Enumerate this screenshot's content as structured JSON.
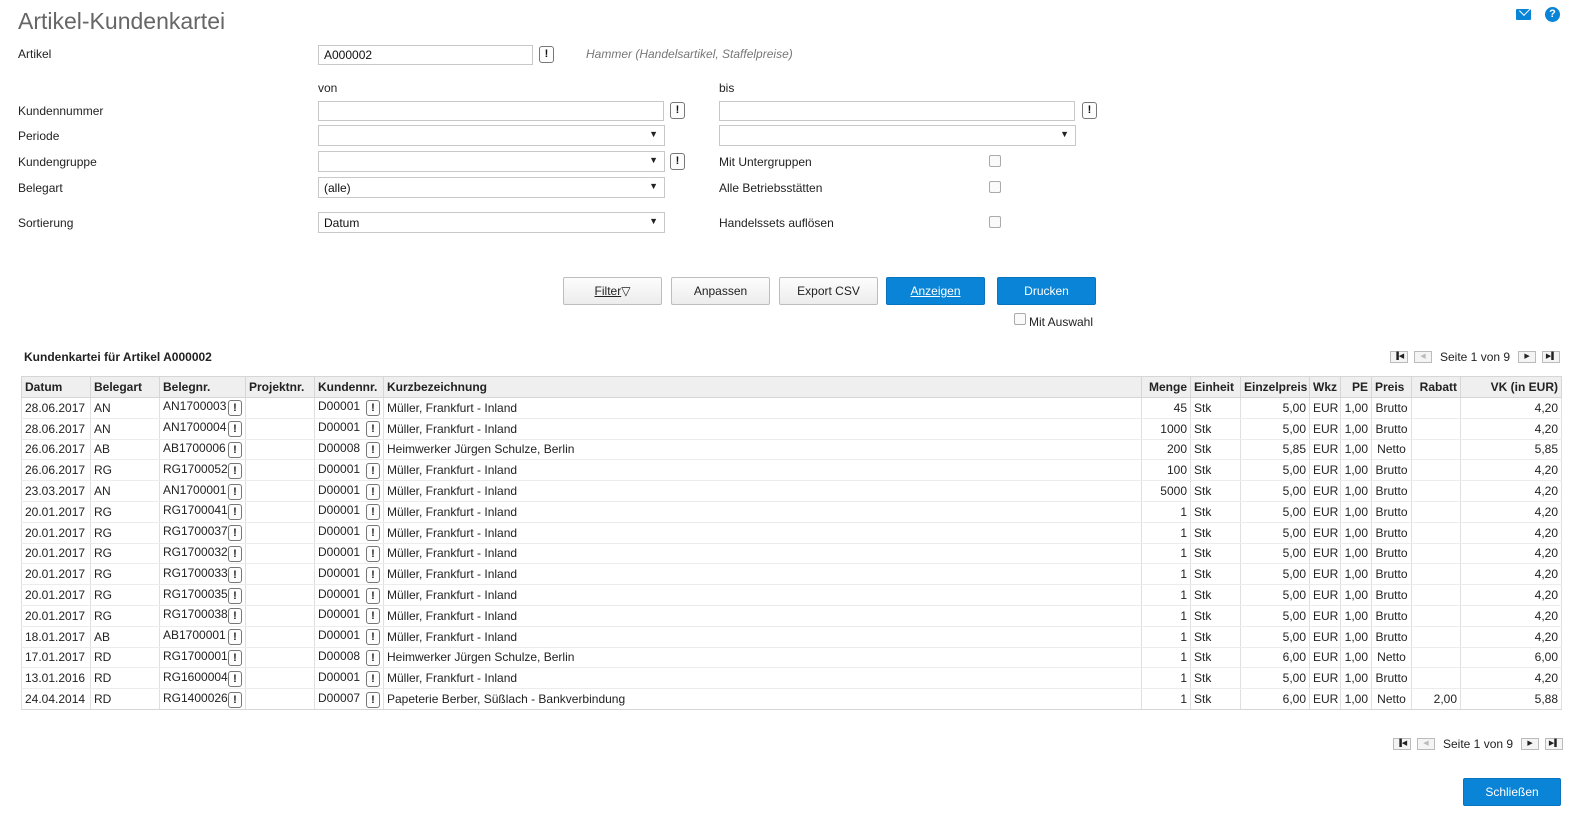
{
  "page": {
    "title": "Artikel-Kundenkartei"
  },
  "icons": {
    "mail": "mail-icon",
    "help": "help-icon"
  },
  "form": {
    "artikel_label": "Artikel",
    "artikel_value": "A000002",
    "artikel_hint": "Hammer (Handelsartikel, Staffelpreise)",
    "von_label": "von",
    "bis_label": "bis",
    "kundennummer_label": "Kundennummer",
    "periode_label": "Periode",
    "kundengruppe_label": "Kundengruppe",
    "belegart_label": "Belegart",
    "belegart_value": "(alle)",
    "sortierung_label": "Sortierung",
    "sortierung_value": "Datum",
    "mit_untergruppen_label": "Mit Untergruppen",
    "alle_betriebsstaetten_label": "Alle Betriebsstätten",
    "handelssets_label": "Handelssets auflösen",
    "mit_auswahl_label": "Mit Auswahl"
  },
  "buttons": {
    "filter": "Filter",
    "anpassen": "Anpassen",
    "export_csv": "Export CSV",
    "anzeigen": "Anzeigen",
    "drucken": "Drucken",
    "schliessen": "Schließen"
  },
  "table": {
    "caption": "Kundenkartei für Artikel A000002",
    "pager_text": "Seite 1 von 9",
    "columns": [
      "Datum",
      "Belegart",
      "Belegnr.",
      "Projektnr.",
      "Kundennr.",
      "Kurzbezeichnung",
      "Menge",
      "Einheit",
      "Einzelpreis",
      "Wkz",
      "PE",
      "Preis",
      "Rabatt",
      "VK (in EUR)"
    ],
    "rows": [
      [
        "28.06.2017",
        "AN",
        "AN1700003",
        "",
        "D00001",
        "Müller, Frankfurt - Inland",
        "45",
        "Stk",
        "5,00",
        "EUR",
        "1,00",
        "Brutto",
        "",
        "4,20"
      ],
      [
        "28.06.2017",
        "AN",
        "AN1700004",
        "",
        "D00001",
        "Müller, Frankfurt - Inland",
        "1000",
        "Stk",
        "5,00",
        "EUR",
        "1,00",
        "Brutto",
        "",
        "4,20"
      ],
      [
        "26.06.2017",
        "AB",
        "AB1700006",
        "",
        "D00008",
        "Heimwerker Jürgen Schulze, Berlin",
        "200",
        "Stk",
        "5,85",
        "EUR",
        "1,00",
        "Netto",
        "",
        "5,85"
      ],
      [
        "26.06.2017",
        "RG",
        "RG1700052",
        "",
        "D00001",
        "Müller, Frankfurt - Inland",
        "100",
        "Stk",
        "5,00",
        "EUR",
        "1,00",
        "Brutto",
        "",
        "4,20"
      ],
      [
        "23.03.2017",
        "AN",
        "AN1700001",
        "",
        "D00001",
        "Müller, Frankfurt - Inland",
        "5000",
        "Stk",
        "5,00",
        "EUR",
        "1,00",
        "Brutto",
        "",
        "4,20"
      ],
      [
        "20.01.2017",
        "RG",
        "RG1700041",
        "",
        "D00001",
        "Müller, Frankfurt - Inland",
        "1",
        "Stk",
        "5,00",
        "EUR",
        "1,00",
        "Brutto",
        "",
        "4,20"
      ],
      [
        "20.01.2017",
        "RG",
        "RG1700037",
        "",
        "D00001",
        "Müller, Frankfurt - Inland",
        "1",
        "Stk",
        "5,00",
        "EUR",
        "1,00",
        "Brutto",
        "",
        "4,20"
      ],
      [
        "20.01.2017",
        "RG",
        "RG1700032",
        "",
        "D00001",
        "Müller, Frankfurt - Inland",
        "1",
        "Stk",
        "5,00",
        "EUR",
        "1,00",
        "Brutto",
        "",
        "4,20"
      ],
      [
        "20.01.2017",
        "RG",
        "RG1700033",
        "",
        "D00001",
        "Müller, Frankfurt - Inland",
        "1",
        "Stk",
        "5,00",
        "EUR",
        "1,00",
        "Brutto",
        "",
        "4,20"
      ],
      [
        "20.01.2017",
        "RG",
        "RG1700035",
        "",
        "D00001",
        "Müller, Frankfurt - Inland",
        "1",
        "Stk",
        "5,00",
        "EUR",
        "1,00",
        "Brutto",
        "",
        "4,20"
      ],
      [
        "20.01.2017",
        "RG",
        "RG1700038",
        "",
        "D00001",
        "Müller, Frankfurt - Inland",
        "1",
        "Stk",
        "5,00",
        "EUR",
        "1,00",
        "Brutto",
        "",
        "4,20"
      ],
      [
        "18.01.2017",
        "AB",
        "AB1700001",
        "",
        "D00001",
        "Müller, Frankfurt - Inland",
        "1",
        "Stk",
        "5,00",
        "EUR",
        "1,00",
        "Brutto",
        "",
        "4,20"
      ],
      [
        "17.01.2017",
        "RD",
        "RG1700001",
        "",
        "D00008",
        "Heimwerker Jürgen Schulze, Berlin",
        "1",
        "Stk",
        "6,00",
        "EUR",
        "1,00",
        "Netto",
        "",
        "6,00"
      ],
      [
        "13.01.2016",
        "RD",
        "RG1600004",
        "",
        "D00001",
        "Müller, Frankfurt - Inland",
        "1",
        "Stk",
        "5,00",
        "EUR",
        "1,00",
        "Brutto",
        "",
        "4,20"
      ],
      [
        "24.04.2014",
        "RD",
        "RG1400026",
        "",
        "D00007",
        "Papeterie Berber, Süßlach - Bankverbindung",
        "1",
        "Stk",
        "6,00",
        "EUR",
        "1,00",
        "Netto",
        "2,00",
        "5,88"
      ]
    ]
  }
}
